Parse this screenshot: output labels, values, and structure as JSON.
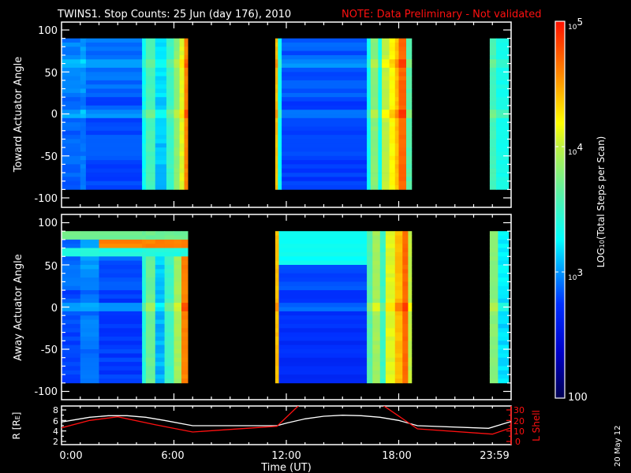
{
  "title": {
    "main": "TWINS1. Stop Counts: 25 Jun (day 176), 2010",
    "note": "NOTE: Data Preliminary - Not validated"
  },
  "colors": {
    "note": "#ff1010",
    "axes": "#ffffff",
    "r_line": "#ffffff",
    "l_line": "#ff1010",
    "background": "#000000"
  },
  "chart_data": [
    {
      "type": "heatmap",
      "name": "toward",
      "ylabel": "Toward Actuator Angle",
      "yticks": [
        "100",
        "50",
        "0",
        "-50",
        "-100"
      ],
      "yrange": [
        -110,
        110
      ],
      "xrange_hours": [
        0,
        24
      ],
      "value_units": "log10 total steps per scan",
      "angle_extent": [
        -90,
        90
      ],
      "bands": [
        [
          0,
          1.0,
          2.9
        ],
        [
          1.0,
          1.3,
          2.95
        ],
        [
          1.3,
          4.3,
          2.85
        ],
        [
          4.3,
          4.5,
          3.3
        ],
        [
          4.5,
          5.0,
          3.55
        ],
        [
          5.0,
          5.6,
          3.15
        ],
        [
          5.6,
          6.0,
          3.5
        ],
        [
          6.0,
          6.3,
          3.8
        ],
        [
          6.3,
          6.55,
          4.1
        ],
        [
          6.55,
          6.74,
          4.6
        ],
        [
          11.41,
          11.55,
          4.4
        ],
        [
          11.55,
          11.75,
          3.3
        ],
        [
          11.75,
          16.3,
          2.8
        ],
        [
          16.3,
          16.5,
          3.3
        ],
        [
          16.5,
          16.9,
          3.8
        ],
        [
          16.9,
          17.1,
          3.3
        ],
        [
          17.1,
          17.5,
          4.0
        ],
        [
          17.5,
          17.8,
          4.2
        ],
        [
          17.8,
          18.0,
          4.4
        ],
        [
          18.0,
          18.4,
          4.7
        ],
        [
          18.4,
          18.69,
          3.6
        ],
        [
          22.86,
          23.2,
          3.55
        ],
        [
          23.2,
          23.87,
          3.35
        ]
      ],
      "features": [],
      "stripes": [
        {
          "angle": 0,
          "delta": 0.18
        },
        {
          "angle": 60,
          "delta": 0.15
        }
      ]
    },
    {
      "type": "heatmap",
      "name": "away",
      "ylabel": "Away Actuator Angle",
      "yticks": [
        "100",
        "50",
        "0",
        "-50",
        "-100"
      ],
      "yrange": [
        -110,
        110
      ],
      "xrange_hours": [
        0,
        24
      ],
      "value_units": "log10 total steps per scan",
      "angle_extent": [
        -90,
        90
      ],
      "bands": [
        [
          0,
          1.0,
          2.85
        ],
        [
          1.0,
          2.0,
          2.95
        ],
        [
          2.0,
          4.3,
          2.8
        ],
        [
          4.3,
          4.5,
          3.4
        ],
        [
          4.5,
          5.0,
          3.7
        ],
        [
          5.0,
          5.5,
          3.1
        ],
        [
          5.5,
          6.0,
          3.5
        ],
        [
          6.0,
          6.4,
          3.9
        ],
        [
          6.4,
          6.74,
          4.6
        ],
        [
          11.41,
          11.6,
          4.4
        ],
        [
          11.6,
          16.3,
          2.75
        ],
        [
          16.3,
          16.6,
          3.6
        ],
        [
          16.6,
          17.0,
          3.9
        ],
        [
          17.0,
          17.3,
          3.5
        ],
        [
          17.3,
          17.8,
          4.1
        ],
        [
          17.8,
          18.2,
          4.4
        ],
        [
          18.2,
          18.5,
          4.7
        ],
        [
          18.5,
          18.69,
          4.0
        ],
        [
          22.86,
          23.3,
          3.8
        ],
        [
          23.3,
          23.87,
          3.2
        ]
      ],
      "features": [
        {
          "t": [
            0,
            6.74
          ],
          "a": [
            60,
            70
          ],
          "v": 3.4
        },
        {
          "t": [
            0,
            6.74
          ],
          "a": [
            80,
            90
          ],
          "v": 3.7
        },
        {
          "t": [
            2.2,
            6.6
          ],
          "a": [
            70,
            80
          ],
          "v": 4.6
        },
        {
          "t": [
            0.9,
            1.3
          ],
          "a": [
            70,
            80
          ],
          "v": 4.4
        },
        {
          "t": [
            11.6,
            14.5
          ],
          "a": [
            50,
            90
          ],
          "v": 3.3
        },
        {
          "t": [
            11.6,
            13.5
          ],
          "a": [
            70,
            90
          ],
          "v": 3.5
        }
      ],
      "stripes": [
        {
          "angle": 0,
          "delta": 0.18
        }
      ]
    },
    {
      "type": "line",
      "name": "orbit",
      "xlabel": "Time (UT)",
      "xticks": [
        "0:00",
        "6:00",
        "12:00",
        "18:00",
        "23:59"
      ],
      "ylabel_left": {
        "pre": "R [R",
        "sub": "E",
        "post": "]"
      },
      "ylabel_right": "L Shell",
      "yticks_left": [
        "2",
        "4",
        "6",
        "8"
      ],
      "yticks_right": [
        "0",
        "10",
        "20",
        "30"
      ],
      "ylim_left": [
        2,
        8
      ],
      "ylim_right": [
        0,
        30
      ],
      "series": [
        {
          "name": "R",
          "axis": "left",
          "x": [
            0,
            1.5,
            2.5,
            3.5,
            4.5,
            5.5,
            7.0,
            11.5,
            12.0,
            13.0,
            14.0,
            15.0,
            16.0,
            17.0,
            18.0,
            19.0,
            22.8,
            23.99
          ],
          "y": [
            5.7,
            6.6,
            6.9,
            6.9,
            6.6,
            6.0,
            5.0,
            5.0,
            5.5,
            6.3,
            6.8,
            7.0,
            6.9,
            6.6,
            6.0,
            5.0,
            4.5,
            5.8
          ]
        },
        {
          "name": "L Shell",
          "axis": "right",
          "x": [
            0,
            1.5,
            3.0,
            5.0,
            7.0,
            11.5,
            13.0,
            16.7,
            19.0,
            23.0,
            23.99
          ],
          "y": [
            13,
            20,
            23.5,
            16,
            9,
            14.5,
            40,
            40,
            12,
            7,
            13
          ]
        }
      ]
    },
    {
      "type": "colorbar",
      "labels": [
        {
          "base": "10",
          "exp": "5"
        },
        {
          "base": "10",
          "exp": "4"
        },
        {
          "base": "10",
          "exp": "3"
        },
        {
          "base": "100",
          "exp": ""
        }
      ],
      "title": {
        "pre": "LOG",
        "sub": "10",
        "post": "(Total Steps per Scan)"
      },
      "range_log10": [
        2,
        5
      ]
    }
  ],
  "footer": {
    "date_stamp": "20 May 12"
  }
}
